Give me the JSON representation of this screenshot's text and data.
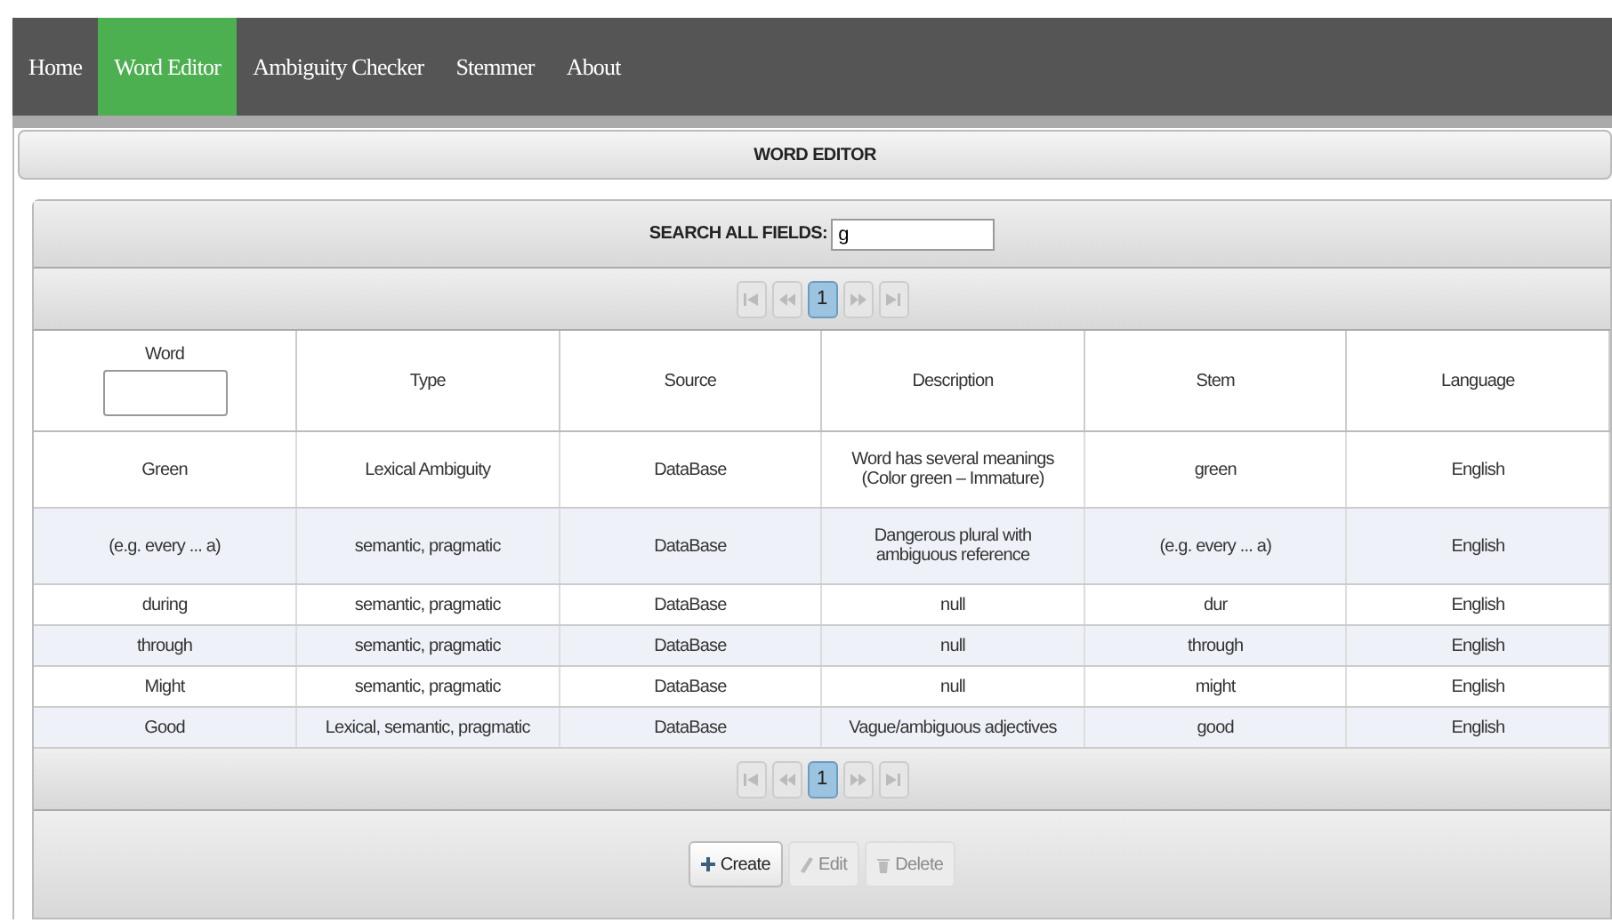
{
  "nav": [
    {
      "label": "Home",
      "selected": false
    },
    {
      "label": "Word Editor",
      "selected": true
    },
    {
      "label": "Ambiguity Checker",
      "selected": false
    },
    {
      "label": "Stemmer",
      "selected": false
    },
    {
      "label": "About",
      "selected": false
    }
  ],
  "panel_title": "WORD EDITOR",
  "search": {
    "label": "SEARCH ALL FIELDS:",
    "value": "g"
  },
  "pager_top": {
    "pages": [
      {
        "label": "1",
        "selected": true
      }
    ]
  },
  "table": {
    "columns": [
      {
        "label": "Word",
        "filter": true
      },
      {
        "label": "Type",
        "filter": false
      },
      {
        "label": "Source",
        "filter": false
      },
      {
        "label": "Description",
        "filter": false
      },
      {
        "label": "Stem",
        "filter": false
      },
      {
        "label": "Language",
        "filter": false
      }
    ],
    "rows": [
      [
        "Green",
        "Lexical Ambiguity",
        "DataBase",
        "Word has several meanings (Color green – Immature)",
        "green",
        "English"
      ],
      [
        "(e.g. every ... a)",
        "semantic, pragmatic",
        "DataBase",
        "Dangerous plural with ambiguous reference",
        "(e.g. every ... a)",
        "English"
      ],
      [
        "during",
        "semantic, pragmatic",
        "DataBase",
        "null",
        "dur",
        "English"
      ],
      [
        "through",
        "semantic, pragmatic",
        "DataBase",
        "null",
        "through",
        "English"
      ],
      [
        "Might",
        "semantic, pragmatic",
        "DataBase",
        "null",
        "might",
        "English"
      ],
      [
        "Good",
        "Lexical, semantic, pragmatic",
        "DataBase",
        "Vague/ambiguous adjectives",
        "good",
        "English"
      ]
    ]
  },
  "pager_bottom": {
    "pages": [
      {
        "label": "1",
        "selected": true
      }
    ]
  },
  "actions": [
    {
      "kind": "create",
      "label": "Create",
      "disabled": false
    },
    {
      "kind": "edit",
      "label": "Edit",
      "disabled": true
    },
    {
      "kind": "delete",
      "label": "Delete",
      "disabled": true
    }
  ]
}
